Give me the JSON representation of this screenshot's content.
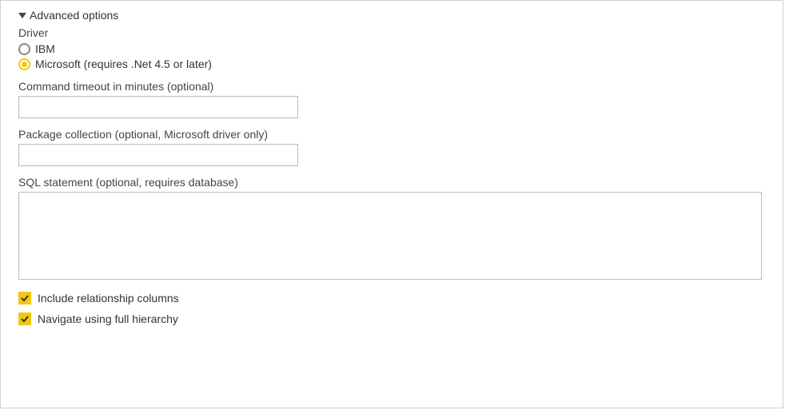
{
  "section": {
    "title": "Advanced options"
  },
  "driver": {
    "label": "Driver",
    "options": {
      "ibm": "IBM",
      "microsoft": "Microsoft (requires .Net 4.5 or later)"
    },
    "selected": "microsoft"
  },
  "fields": {
    "timeout": {
      "label": "Command timeout in minutes (optional)",
      "value": ""
    },
    "package": {
      "label": "Package collection (optional, Microsoft driver only)",
      "value": ""
    },
    "sql": {
      "label": "SQL statement (optional, requires database)",
      "value": ""
    }
  },
  "checkboxes": {
    "relationships": {
      "label": "Include relationship columns",
      "checked": true
    },
    "hierarchy": {
      "label": "Navigate using full hierarchy",
      "checked": true
    }
  }
}
